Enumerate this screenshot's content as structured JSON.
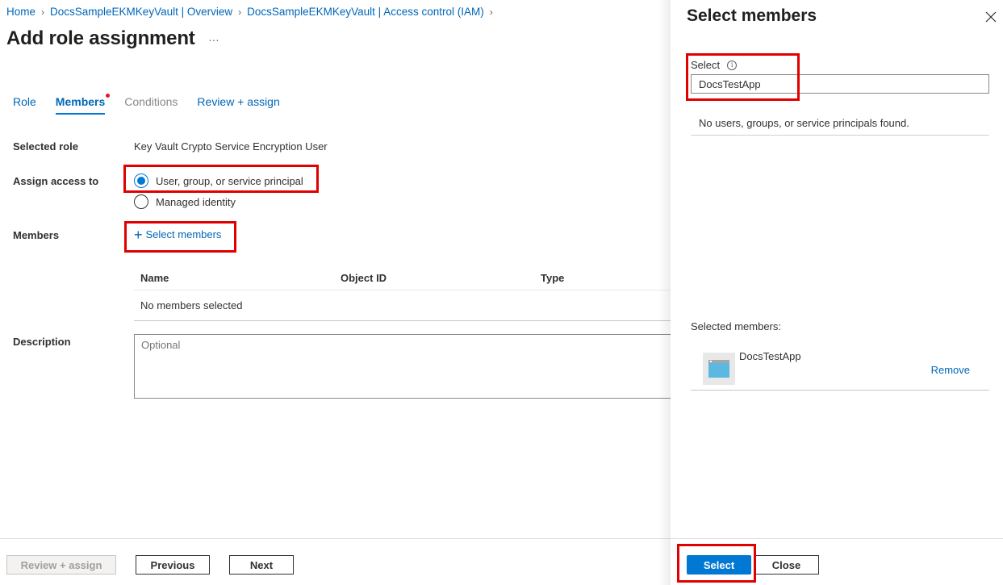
{
  "breadcrumb": [
    {
      "label": "Home"
    },
    {
      "label": "DocsSampleEKMKeyVault | Overview"
    },
    {
      "label": "DocsSampleEKMKeyVault | Access control (IAM)"
    }
  ],
  "page": {
    "title": "Add role assignment",
    "more_icon": "ellipsis-icon"
  },
  "tabs": [
    {
      "label": "Role",
      "state": "normal"
    },
    {
      "label": "Members",
      "state": "active",
      "has_indicator": true
    },
    {
      "label": "Conditions",
      "state": "disabled"
    },
    {
      "label": "Review + assign",
      "state": "normal"
    }
  ],
  "form": {
    "selected_role_label": "Selected role",
    "selected_role_value": "Key Vault Crypto Service Encryption User",
    "assign_access_label": "Assign access to",
    "assign_access_options": [
      {
        "label": "User, group, or service principal",
        "checked": true
      },
      {
        "label": "Managed identity",
        "checked": false
      }
    ],
    "members_label": "Members",
    "select_members_link": "Select members",
    "members_table": {
      "columns": [
        "Name",
        "Object ID",
        "Type"
      ],
      "empty_text": "No members selected"
    },
    "description_label": "Description",
    "description_placeholder": "Optional"
  },
  "footer": {
    "review_assign": "Review + assign",
    "previous": "Previous",
    "next": "Next"
  },
  "panel": {
    "title": "Select members",
    "close_icon": "close-icon",
    "select_label": "Select",
    "search_value": "DocsTestApp",
    "no_results": "No users, groups, or service principals found.",
    "selected_members_label": "Selected members:",
    "selected_members": [
      {
        "name": "DocsTestApp",
        "icon": "app-registration-icon",
        "remove_label": "Remove"
      }
    ],
    "select_button": "Select",
    "close_button": "Close"
  },
  "colors": {
    "accent": "#0078d4",
    "link": "#0067b8",
    "highlight_box": "#e00000",
    "indicator_dot": "#e81123"
  }
}
